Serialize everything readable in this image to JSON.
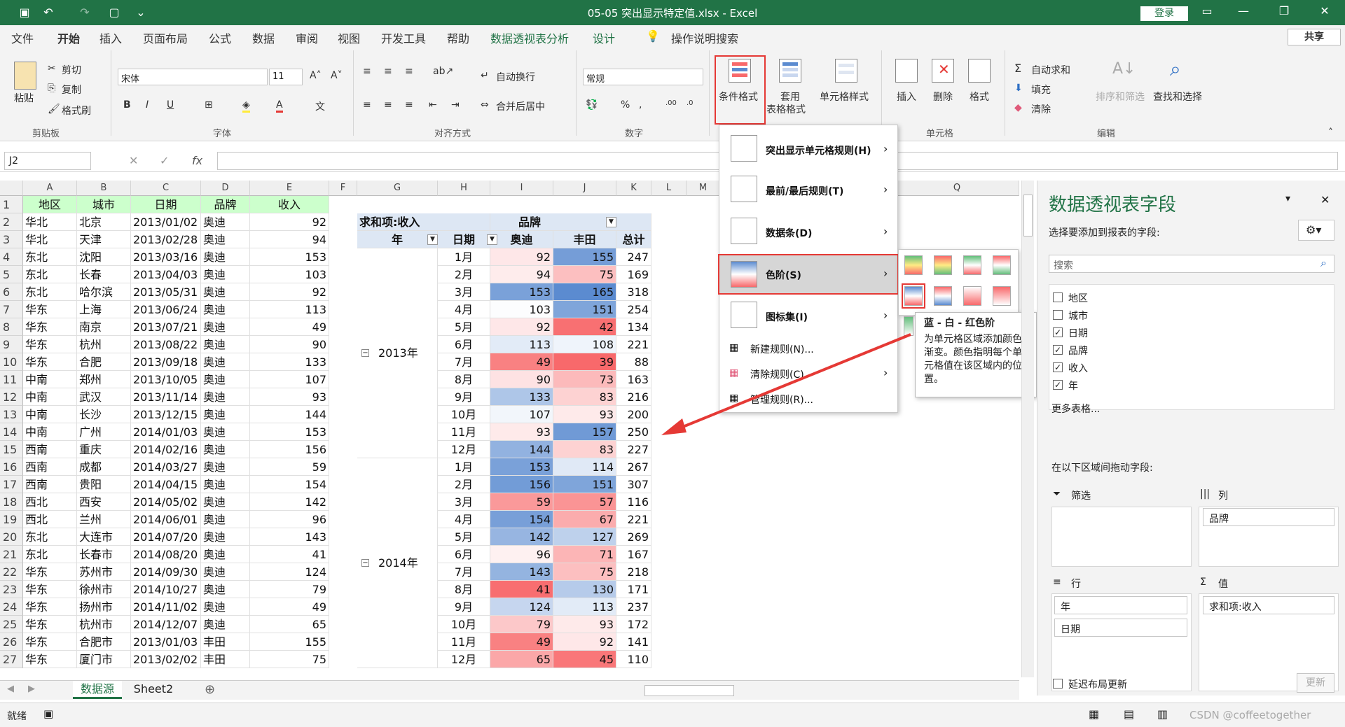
{
  "title_bar": {
    "file_title": "05-05 突出显示特定值.xlsx  -  Excel",
    "login": "登录"
  },
  "tabs": [
    "文件",
    "开始",
    "插入",
    "页面布局",
    "公式",
    "数据",
    "审阅",
    "视图",
    "开发工具",
    "帮助",
    "数据透视表分析",
    "设计"
  ],
  "search_hint": "操作说明搜索",
  "share": "共享",
  "ribbon": {
    "paste": "粘贴",
    "cut": "剪切",
    "copy": "复制",
    "format_painter": "格式刷",
    "clipboard_group": "剪贴板",
    "font_name": "宋体",
    "font_size": "11",
    "font_group": "字体",
    "wrap": "自动换行",
    "merge": "合并后居中",
    "align_group": "对齐方式",
    "number_format": "常规",
    "number_group": "数字",
    "cond_format": "条件格式",
    "table_format_1": "套用",
    "table_format_2": "表格格式",
    "cell_styles": "单元格样式",
    "insert": "插入",
    "delete": "删除",
    "format": "格式",
    "cells_group": "单元格",
    "autosum": "自动求和",
    "fill": "填充",
    "clear": "清除",
    "sort_filter": "排序和筛选",
    "find_select": "查找和选择",
    "edit_group": "编辑"
  },
  "formula_bar": {
    "name_box": "J2",
    "fx": "fx",
    "value": ""
  },
  "columns": [
    "A",
    "B",
    "C",
    "D",
    "E",
    "F",
    "G",
    "H",
    "I",
    "J",
    "K",
    "L",
    "M",
    "N",
    "O",
    "P",
    "Q"
  ],
  "rows": [
    "1",
    "2",
    "3",
    "4",
    "5",
    "6",
    "7",
    "8",
    "9",
    "10",
    "11",
    "12",
    "13",
    "14",
    "15",
    "16",
    "17",
    "18",
    "19",
    "20",
    "21",
    "22",
    "23",
    "24",
    "25",
    "26",
    "27"
  ],
  "source_header": [
    "地区",
    "城市",
    "日期",
    "品牌",
    "收入"
  ],
  "source_rows": [
    [
      "华北",
      "北京",
      "2013/01/02",
      "奥迪",
      "92"
    ],
    [
      "华北",
      "天津",
      "2013/02/28",
      "奥迪",
      "94"
    ],
    [
      "东北",
      "沈阳",
      "2013/03/16",
      "奥迪",
      "153"
    ],
    [
      "东北",
      "长春",
      "2013/04/03",
      "奥迪",
      "103"
    ],
    [
      "东北",
      "哈尔滨",
      "2013/05/31",
      "奥迪",
      "92"
    ],
    [
      "华东",
      "上海",
      "2013/06/24",
      "奥迪",
      "113"
    ],
    [
      "华东",
      "南京",
      "2013/07/21",
      "奥迪",
      "49"
    ],
    [
      "华东",
      "杭州",
      "2013/08/22",
      "奥迪",
      "90"
    ],
    [
      "华东",
      "合肥",
      "2013/09/18",
      "奥迪",
      "133"
    ],
    [
      "中南",
      "郑州",
      "2013/10/05",
      "奥迪",
      "107"
    ],
    [
      "中南",
      "武汉",
      "2013/11/14",
      "奥迪",
      "93"
    ],
    [
      "中南",
      "长沙",
      "2013/12/15",
      "奥迪",
      "144"
    ],
    [
      "中南",
      "广州",
      "2014/01/03",
      "奥迪",
      "153"
    ],
    [
      "西南",
      "重庆",
      "2014/02/16",
      "奥迪",
      "156"
    ],
    [
      "西南",
      "成都",
      "2014/03/27",
      "奥迪",
      "59"
    ],
    [
      "西南",
      "贵阳",
      "2014/04/15",
      "奥迪",
      "154"
    ],
    [
      "西北",
      "西安",
      "2014/05/02",
      "奥迪",
      "142"
    ],
    [
      "西北",
      "兰州",
      "2014/06/01",
      "奥迪",
      "96"
    ],
    [
      "东北",
      "大连市",
      "2014/07/20",
      "奥迪",
      "143"
    ],
    [
      "东北",
      "长春市",
      "2014/08/20",
      "奥迪",
      "41"
    ],
    [
      "华东",
      "苏州市",
      "2014/09/30",
      "奥迪",
      "124"
    ],
    [
      "华东",
      "徐州市",
      "2014/10/27",
      "奥迪",
      "79"
    ],
    [
      "华东",
      "扬州市",
      "2014/11/02",
      "奥迪",
      "49"
    ],
    [
      "华东",
      "杭州市",
      "2014/12/07",
      "奥迪",
      "65"
    ],
    [
      "华东",
      "合肥市",
      "2013/01/03",
      "丰田",
      "155"
    ],
    [
      "华东",
      "厦门市",
      "2013/02/02",
      "丰田",
      "75"
    ]
  ],
  "pivot": {
    "sum_label": "求和项:收入",
    "brand_label": "品牌",
    "year_label": "年",
    "date_label": "日期",
    "brands": [
      "奥迪",
      "丰田"
    ],
    "total_label": "总计",
    "years": [
      {
        "name": "2013年",
        "months": [
          [
            "1月",
            "92",
            "155",
            "247"
          ],
          [
            "2月",
            "94",
            "75",
            "169"
          ],
          [
            "3月",
            "153",
            "165",
            "318"
          ],
          [
            "4月",
            "103",
            "151",
            "254"
          ],
          [
            "5月",
            "92",
            "42",
            "134"
          ],
          [
            "6月",
            "113",
            "108",
            "221"
          ],
          [
            "7月",
            "49",
            "39",
            "88"
          ],
          [
            "8月",
            "90",
            "73",
            "163"
          ],
          [
            "9月",
            "133",
            "83",
            "216"
          ],
          [
            "10月",
            "107",
            "93",
            "200"
          ],
          [
            "11月",
            "93",
            "157",
            "250"
          ],
          [
            "12月",
            "144",
            "83",
            "227"
          ]
        ]
      },
      {
        "name": "2014年",
        "months": [
          [
            "1月",
            "153",
            "114",
            "267"
          ],
          [
            "2月",
            "156",
            "151",
            "307"
          ],
          [
            "3月",
            "59",
            "57",
            "116"
          ],
          [
            "4月",
            "154",
            "67",
            "221"
          ],
          [
            "5月",
            "142",
            "127",
            "269"
          ],
          [
            "6月",
            "96",
            "71",
            "167"
          ],
          [
            "7月",
            "143",
            "75",
            "218"
          ],
          [
            "8月",
            "41",
            "130",
            "171"
          ],
          [
            "9月",
            "124",
            "113",
            "237"
          ],
          [
            "10月",
            "79",
            "93",
            "172"
          ],
          [
            "11月",
            "49",
            "92",
            "141"
          ],
          [
            "12月",
            "65",
            "45",
            "110"
          ]
        ]
      }
    ],
    "partial_label": "总计"
  },
  "cf_menu": {
    "highlight": "突出显示单元格规则(H)",
    "topbottom": "最前/最后规则(T)",
    "databar": "数据条(D)",
    "colorscale": "色阶(S)",
    "iconset": "图标集(I)",
    "new_rule": "新建规则(N)...",
    "clear_rule": "清除规则(C)",
    "manage_rule": "管理规则(R)..."
  },
  "tooltip": {
    "title": "蓝 - 白 - 红色阶",
    "body": "为单元格区域添加颜色渐变。颜色指明每个单元格值在该区域内的位置。"
  },
  "pane": {
    "title": "数据透视表字段",
    "subtitle": "选择要添加到报表的字段:",
    "search_placeholder": "搜索",
    "fields": [
      {
        "name": "地区",
        "checked": false
      },
      {
        "name": "城市",
        "checked": false
      },
      {
        "name": "日期",
        "checked": true
      },
      {
        "name": "品牌",
        "checked": true
      },
      {
        "name": "收入",
        "checked": true
      },
      {
        "name": "年",
        "checked": true
      }
    ],
    "more_tables": "更多表格...",
    "drag_hint": "在以下区域间拖动字段:",
    "filter": "筛选",
    "columns": "列",
    "rows": "行",
    "values": "值",
    "col_item": "品牌",
    "row_items": [
      "年",
      "日期"
    ],
    "value_item": "求和项:收入",
    "defer": "延迟布局更新",
    "update": "更新"
  },
  "sheets": [
    "数据源",
    "Sheet2"
  ],
  "status": {
    "ready": "就绪",
    "watermark": "CSDN @coffeetogether"
  },
  "colors": {
    "excel_green": "#217346",
    "highlight_red": "#e53935",
    "scale_blue": "#5b8bd0",
    "scale_red": "#f8696b"
  }
}
